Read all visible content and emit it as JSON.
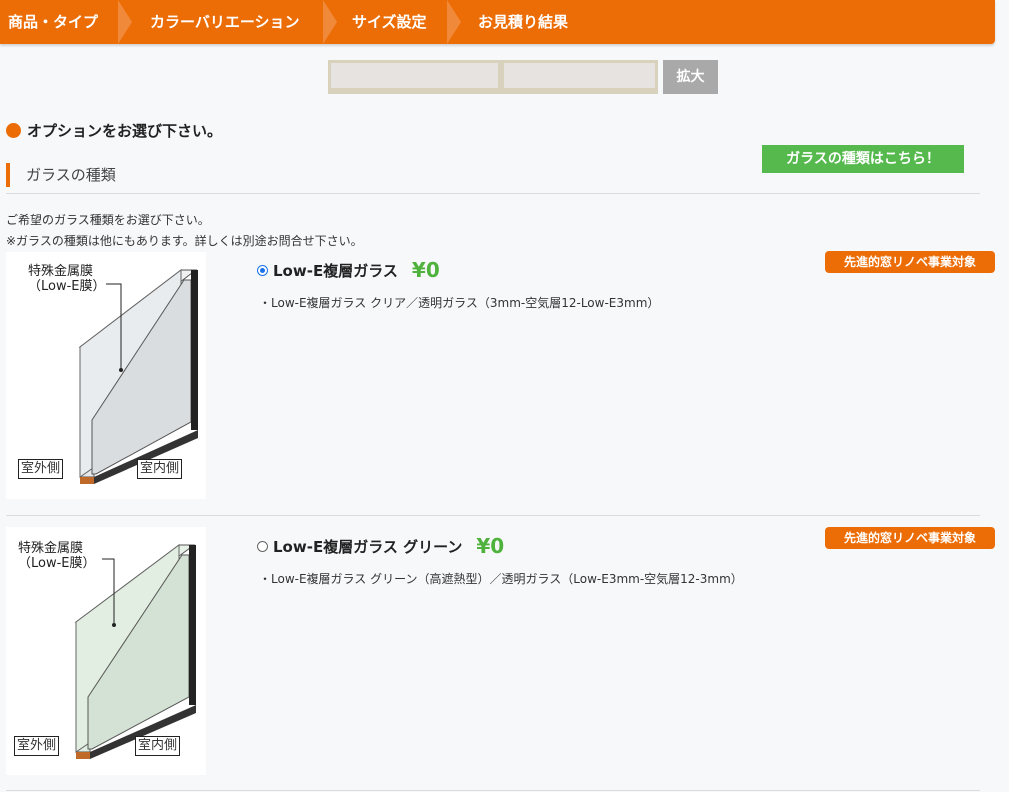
{
  "steps": [
    "商品・タイプ",
    "カラーバリエーション",
    "サイズ設定",
    "お見積り結果"
  ],
  "zoom_label": "拡大",
  "options_heading": "オプションをお選び下さい。",
  "section_title": "ガラスの種類",
  "glass_types_link": "ガラスの種類はこちら！",
  "instructions": [
    "ご希望のガラス種類をお選び下さい。",
    "※ガラスの種類は他にもあります。詳しくは別途お問合せ下さい。"
  ],
  "diagram_labels": {
    "film_line1": "特殊金属膜",
    "film_line2": "（Low-E膜）",
    "outside": "室外側",
    "inside": "室内側"
  },
  "options": [
    {
      "name": "Low-E複層ガラス",
      "price": "¥0",
      "selected": true,
      "description": "・Low-E複層ガラス クリア／透明ガラス（3mm-空気層12-Low-E3mm）",
      "badge": "先進的窓リノベ事業対象",
      "glass_color": "clear"
    },
    {
      "name": "Low-E複層ガラス グリーン",
      "price": "¥0",
      "selected": false,
      "description": "・Low-E複層ガラス グリーン（高遮熱型）／透明ガラス（Low-E3mm-空気層12-3mm）",
      "badge": "先進的窓リノベ事業対象",
      "glass_color": "green"
    }
  ],
  "colors": {
    "accent": "#ec6c06",
    "price": "#4fb23c",
    "link_button": "#56b94e",
    "zoom_button": "#a9a9a9"
  }
}
